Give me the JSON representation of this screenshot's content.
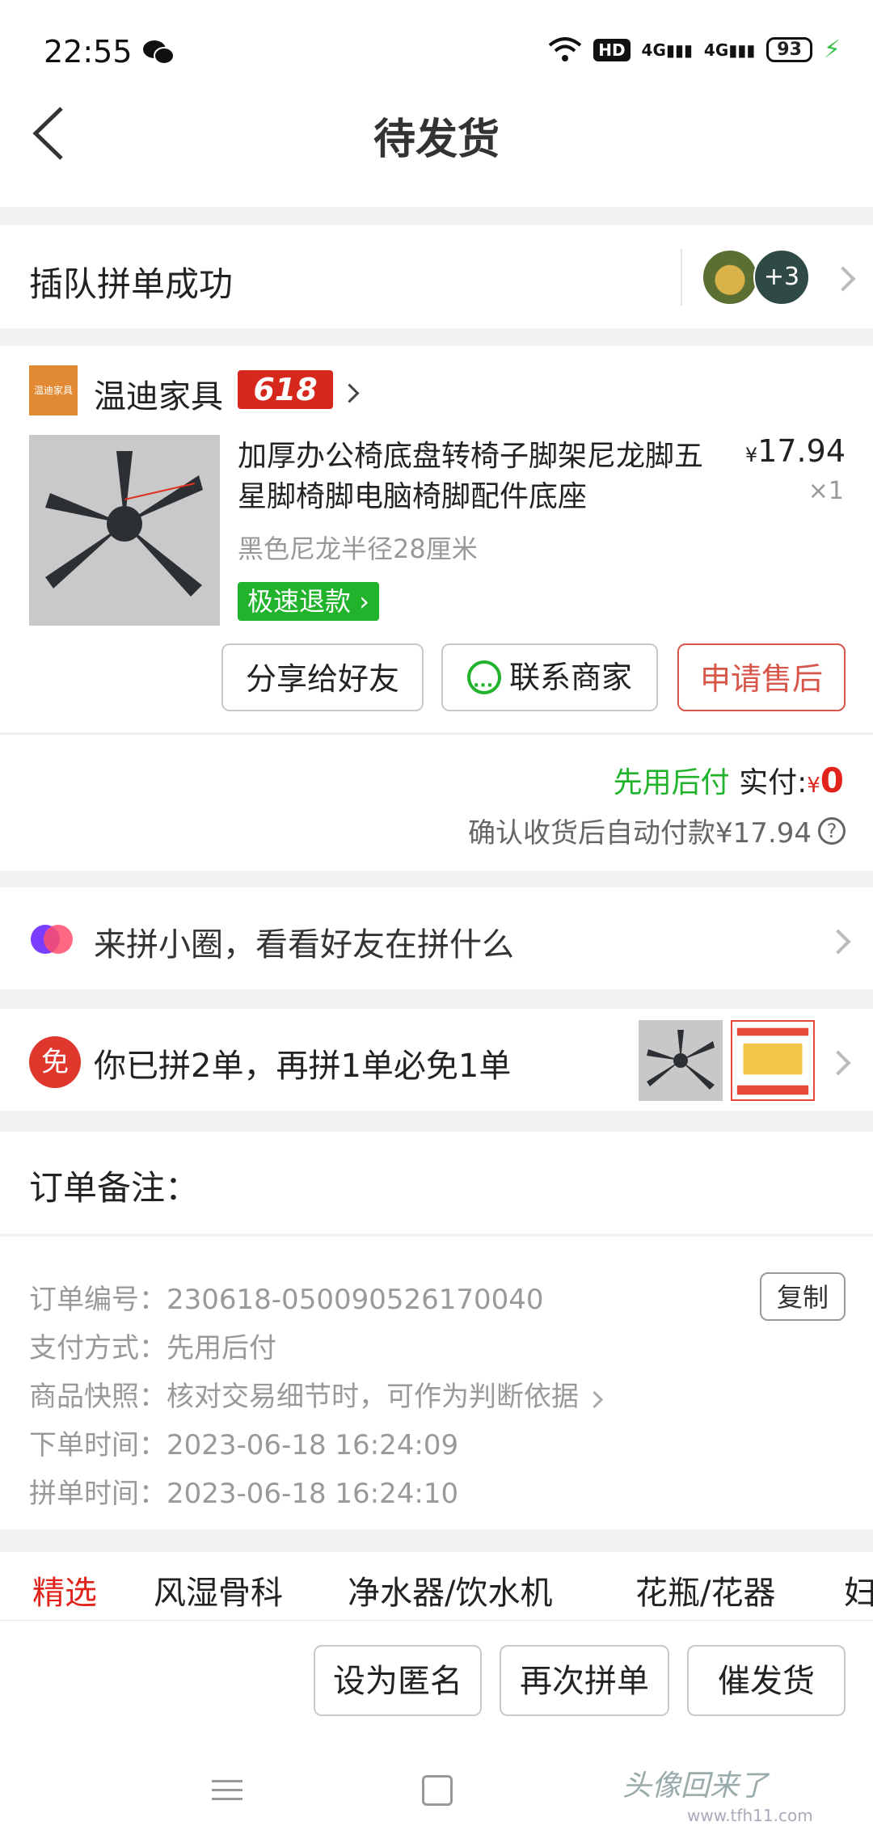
{
  "status_bar": {
    "time": "22:55",
    "hd": "HD",
    "net1": "4G",
    "net2": "4G",
    "battery": "93",
    "icons": [
      "wechat-icon",
      "wifi-icon",
      "signal-icon",
      "battery-icon",
      "charging-icon"
    ]
  },
  "header": {
    "title": "待发货"
  },
  "group": {
    "text": "插队拼单成功",
    "extra_count": "+3"
  },
  "shop": {
    "name": "温迪家具",
    "logo_text": "温迪家具",
    "badge": "618",
    "product": {
      "title": "加厚办公椅底盘转椅子脚架尼龙脚五星脚椅脚电脑椅脚配件底座",
      "currency": "¥",
      "price": "17.94",
      "qty": "×1",
      "spec": "黑色尼龙半径28厘米",
      "refund_tag": "极速退款"
    },
    "buttons": {
      "share": "分享给好友",
      "contact": "联系商家",
      "after_sale": "申请售后"
    },
    "payment": {
      "method_label": "先用后付",
      "paid_label": "实付:",
      "currency": "¥",
      "paid_value": "0",
      "auto_pay": "确认收货后自动付款¥17.94"
    }
  },
  "circle": {
    "text": "来拼小圈，看看好友在拼什么"
  },
  "free": {
    "icon_text": "免",
    "text": "你已拼2单，再拼1单必免1单"
  },
  "note": {
    "label": "订单备注："
  },
  "details": {
    "order_no_label": "订单编号：",
    "order_no": "230618-050090526170040",
    "copy": "复制",
    "pay_label": "支付方式：",
    "pay_value": "先用后付",
    "snapshot_label": "商品快照：",
    "snapshot_value": "核对交易细节时，可作为判断依据",
    "order_time_label": "下单时间：",
    "order_time": "2023-06-18 16:24:09",
    "group_time_label": "拼单时间：",
    "group_time": "2023-06-18 16:24:10"
  },
  "categories": [
    "精选",
    "风湿骨科",
    "净水器/饮水机",
    "花瓶/花器",
    "妇"
  ],
  "actions": {
    "anonymous": "设为匿名",
    "regroup": "再次拼单",
    "urge": "催发货"
  },
  "watermark": {
    "text": "头像回来了",
    "url": "www.tfh11.com"
  },
  "colors": {
    "accent_red": "#e0241b",
    "green": "#20b32b",
    "badge_red": "#d7281d"
  }
}
